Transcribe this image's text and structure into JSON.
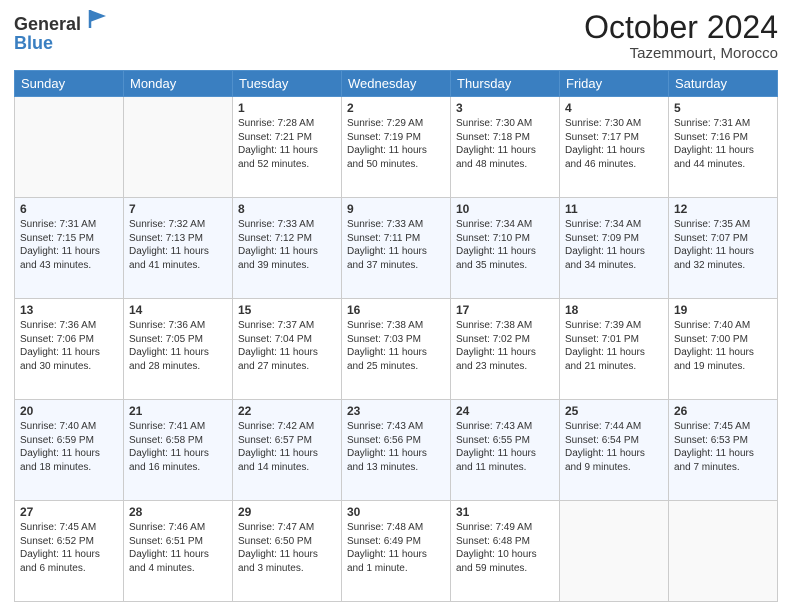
{
  "header": {
    "logo_line1": "General",
    "logo_line2": "Blue",
    "month": "October 2024",
    "location": "Tazemmourt, Morocco"
  },
  "days_of_week": [
    "Sunday",
    "Monday",
    "Tuesday",
    "Wednesday",
    "Thursday",
    "Friday",
    "Saturday"
  ],
  "weeks": [
    [
      {
        "day": "",
        "sunrise": "",
        "sunset": "",
        "daylight": ""
      },
      {
        "day": "",
        "sunrise": "",
        "sunset": "",
        "daylight": ""
      },
      {
        "day": "1",
        "sunrise": "Sunrise: 7:28 AM",
        "sunset": "Sunset: 7:21 PM",
        "daylight": "Daylight: 11 hours and 52 minutes."
      },
      {
        "day": "2",
        "sunrise": "Sunrise: 7:29 AM",
        "sunset": "Sunset: 7:19 PM",
        "daylight": "Daylight: 11 hours and 50 minutes."
      },
      {
        "day": "3",
        "sunrise": "Sunrise: 7:30 AM",
        "sunset": "Sunset: 7:18 PM",
        "daylight": "Daylight: 11 hours and 48 minutes."
      },
      {
        "day": "4",
        "sunrise": "Sunrise: 7:30 AM",
        "sunset": "Sunset: 7:17 PM",
        "daylight": "Daylight: 11 hours and 46 minutes."
      },
      {
        "day": "5",
        "sunrise": "Sunrise: 7:31 AM",
        "sunset": "Sunset: 7:16 PM",
        "daylight": "Daylight: 11 hours and 44 minutes."
      }
    ],
    [
      {
        "day": "6",
        "sunrise": "Sunrise: 7:31 AM",
        "sunset": "Sunset: 7:15 PM",
        "daylight": "Daylight: 11 hours and 43 minutes."
      },
      {
        "day": "7",
        "sunrise": "Sunrise: 7:32 AM",
        "sunset": "Sunset: 7:13 PM",
        "daylight": "Daylight: 11 hours and 41 minutes."
      },
      {
        "day": "8",
        "sunrise": "Sunrise: 7:33 AM",
        "sunset": "Sunset: 7:12 PM",
        "daylight": "Daylight: 11 hours and 39 minutes."
      },
      {
        "day": "9",
        "sunrise": "Sunrise: 7:33 AM",
        "sunset": "Sunset: 7:11 PM",
        "daylight": "Daylight: 11 hours and 37 minutes."
      },
      {
        "day": "10",
        "sunrise": "Sunrise: 7:34 AM",
        "sunset": "Sunset: 7:10 PM",
        "daylight": "Daylight: 11 hours and 35 minutes."
      },
      {
        "day": "11",
        "sunrise": "Sunrise: 7:34 AM",
        "sunset": "Sunset: 7:09 PM",
        "daylight": "Daylight: 11 hours and 34 minutes."
      },
      {
        "day": "12",
        "sunrise": "Sunrise: 7:35 AM",
        "sunset": "Sunset: 7:07 PM",
        "daylight": "Daylight: 11 hours and 32 minutes."
      }
    ],
    [
      {
        "day": "13",
        "sunrise": "Sunrise: 7:36 AM",
        "sunset": "Sunset: 7:06 PM",
        "daylight": "Daylight: 11 hours and 30 minutes."
      },
      {
        "day": "14",
        "sunrise": "Sunrise: 7:36 AM",
        "sunset": "Sunset: 7:05 PM",
        "daylight": "Daylight: 11 hours and 28 minutes."
      },
      {
        "day": "15",
        "sunrise": "Sunrise: 7:37 AM",
        "sunset": "Sunset: 7:04 PM",
        "daylight": "Daylight: 11 hours and 27 minutes."
      },
      {
        "day": "16",
        "sunrise": "Sunrise: 7:38 AM",
        "sunset": "Sunset: 7:03 PM",
        "daylight": "Daylight: 11 hours and 25 minutes."
      },
      {
        "day": "17",
        "sunrise": "Sunrise: 7:38 AM",
        "sunset": "Sunset: 7:02 PM",
        "daylight": "Daylight: 11 hours and 23 minutes."
      },
      {
        "day": "18",
        "sunrise": "Sunrise: 7:39 AM",
        "sunset": "Sunset: 7:01 PM",
        "daylight": "Daylight: 11 hours and 21 minutes."
      },
      {
        "day": "19",
        "sunrise": "Sunrise: 7:40 AM",
        "sunset": "Sunset: 7:00 PM",
        "daylight": "Daylight: 11 hours and 19 minutes."
      }
    ],
    [
      {
        "day": "20",
        "sunrise": "Sunrise: 7:40 AM",
        "sunset": "Sunset: 6:59 PM",
        "daylight": "Daylight: 11 hours and 18 minutes."
      },
      {
        "day": "21",
        "sunrise": "Sunrise: 7:41 AM",
        "sunset": "Sunset: 6:58 PM",
        "daylight": "Daylight: 11 hours and 16 minutes."
      },
      {
        "day": "22",
        "sunrise": "Sunrise: 7:42 AM",
        "sunset": "Sunset: 6:57 PM",
        "daylight": "Daylight: 11 hours and 14 minutes."
      },
      {
        "day": "23",
        "sunrise": "Sunrise: 7:43 AM",
        "sunset": "Sunset: 6:56 PM",
        "daylight": "Daylight: 11 hours and 13 minutes."
      },
      {
        "day": "24",
        "sunrise": "Sunrise: 7:43 AM",
        "sunset": "Sunset: 6:55 PM",
        "daylight": "Daylight: 11 hours and 11 minutes."
      },
      {
        "day": "25",
        "sunrise": "Sunrise: 7:44 AM",
        "sunset": "Sunset: 6:54 PM",
        "daylight": "Daylight: 11 hours and 9 minutes."
      },
      {
        "day": "26",
        "sunrise": "Sunrise: 7:45 AM",
        "sunset": "Sunset: 6:53 PM",
        "daylight": "Daylight: 11 hours and 7 minutes."
      }
    ],
    [
      {
        "day": "27",
        "sunrise": "Sunrise: 7:45 AM",
        "sunset": "Sunset: 6:52 PM",
        "daylight": "Daylight: 11 hours and 6 minutes."
      },
      {
        "day": "28",
        "sunrise": "Sunrise: 7:46 AM",
        "sunset": "Sunset: 6:51 PM",
        "daylight": "Daylight: 11 hours and 4 minutes."
      },
      {
        "day": "29",
        "sunrise": "Sunrise: 7:47 AM",
        "sunset": "Sunset: 6:50 PM",
        "daylight": "Daylight: 11 hours and 3 minutes."
      },
      {
        "day": "30",
        "sunrise": "Sunrise: 7:48 AM",
        "sunset": "Sunset: 6:49 PM",
        "daylight": "Daylight: 11 hours and 1 minute."
      },
      {
        "day": "31",
        "sunrise": "Sunrise: 7:49 AM",
        "sunset": "Sunset: 6:48 PM",
        "daylight": "Daylight: 10 hours and 59 minutes."
      },
      {
        "day": "",
        "sunrise": "",
        "sunset": "",
        "daylight": ""
      },
      {
        "day": "",
        "sunrise": "",
        "sunset": "",
        "daylight": ""
      }
    ]
  ]
}
